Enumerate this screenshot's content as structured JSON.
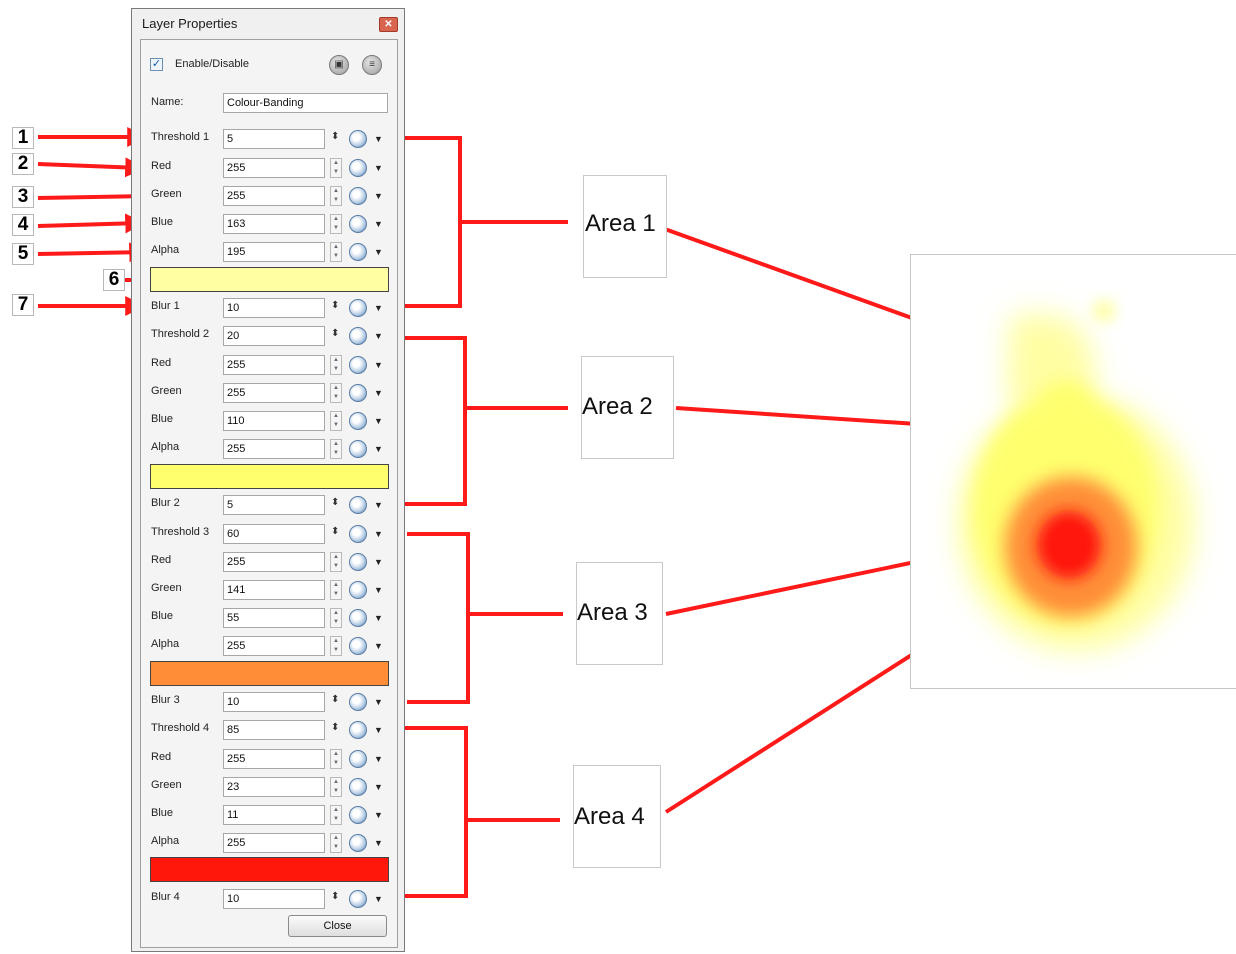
{
  "window": {
    "title": "Layer Properties",
    "close_icon": "close-x-icon",
    "enable_label": "Enable/Disable",
    "enable_checked": true,
    "name_label": "Name:",
    "name_value": "Colour-Banding",
    "close_label": "Close"
  },
  "labels": {
    "threshold1": "Threshold 1",
    "threshold2": "Threshold 2",
    "threshold3": "Threshold 3",
    "threshold4": "Threshold 4",
    "red": "Red",
    "green": "Green",
    "blue": "Blue",
    "alpha": "Alpha",
    "blur1": "Blur 1",
    "blur2": "Blur 2",
    "blur3": "Blur 3",
    "blur4": "Blur 4"
  },
  "values": {
    "threshold1": "5",
    "red1": "255",
    "green1": "255",
    "blue1": "163",
    "alpha1": "195",
    "blur1": "10",
    "threshold2": "20",
    "red2": "255",
    "green2": "255",
    "blue2": "110",
    "alpha2": "255",
    "blur2": "5",
    "threshold3": "60",
    "red3": "255",
    "green3": "141",
    "blue3": "55",
    "alpha3": "255",
    "blur3": "10",
    "threshold4": "85",
    "red4": "255",
    "green4": "23",
    "blue4": "11",
    "alpha4": "255",
    "blur4": "10"
  },
  "swatches": [
    "#fffea3",
    "#ffff6e",
    "#ff8d37",
    "#ff170b"
  ],
  "callout_numbers": [
    "1",
    "2",
    "3",
    "4",
    "5",
    "6",
    "7"
  ],
  "areas": [
    "Area 1",
    "Area 2",
    "Area 3",
    "Area 4"
  ],
  "colors": {
    "arrow": "#ff1a1a",
    "bracket": "#ff1a1a"
  }
}
